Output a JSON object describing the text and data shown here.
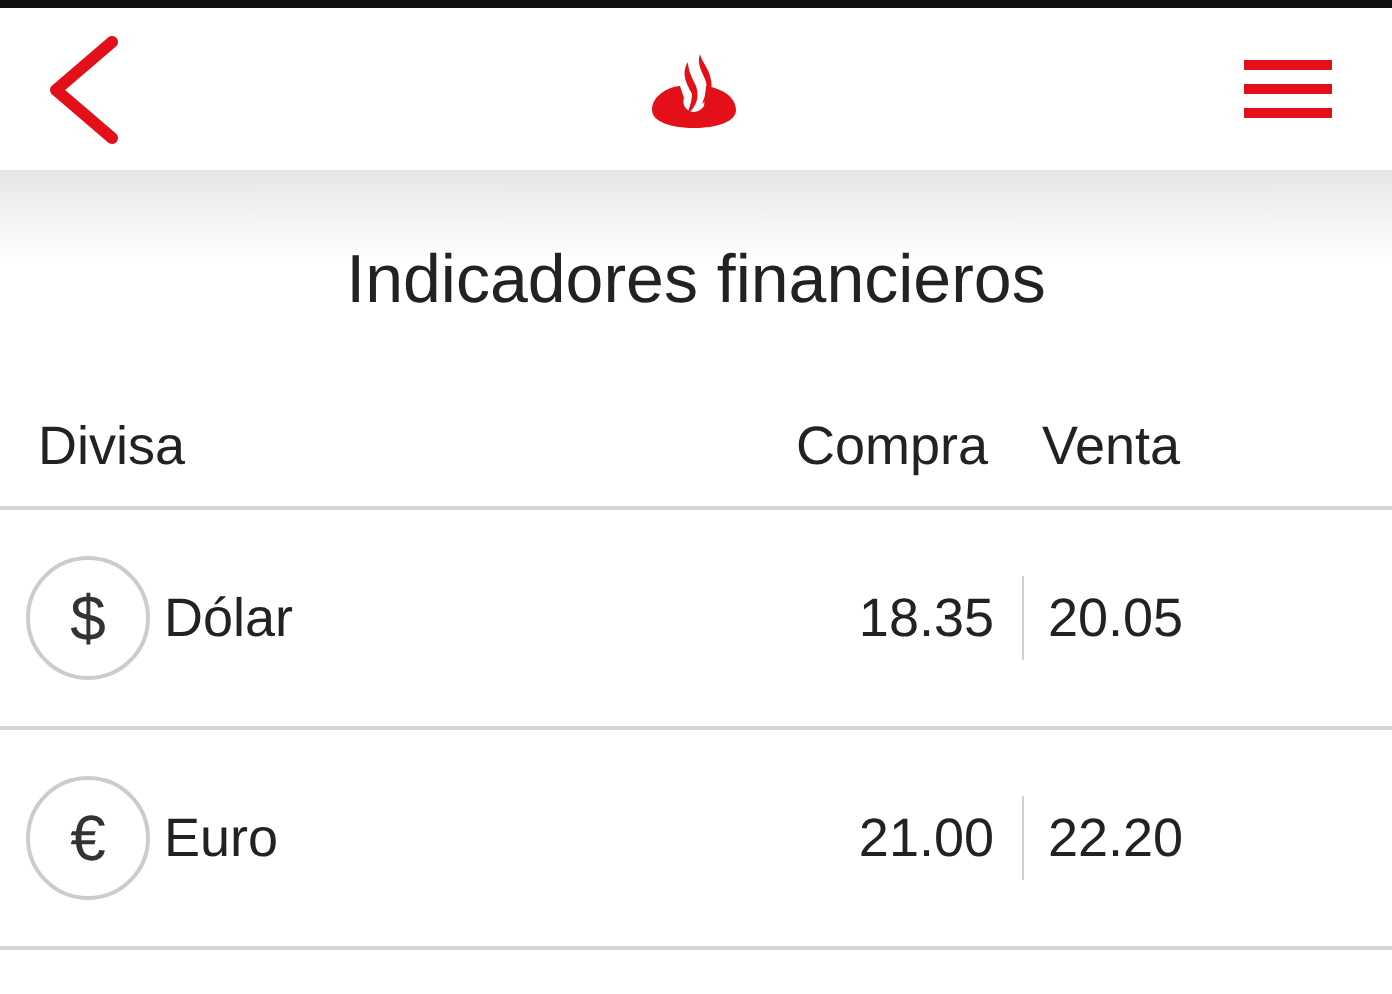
{
  "title": "Indicadores financieros",
  "table": {
    "columns": [
      "Divisa",
      "Compra",
      "Venta"
    ],
    "rows": [
      {
        "symbol": "$",
        "name": "Dólar",
        "buy": "18.35",
        "sell": "20.05"
      },
      {
        "symbol": "€",
        "name": "Euro",
        "buy": "21.00",
        "sell": "22.20"
      }
    ]
  }
}
